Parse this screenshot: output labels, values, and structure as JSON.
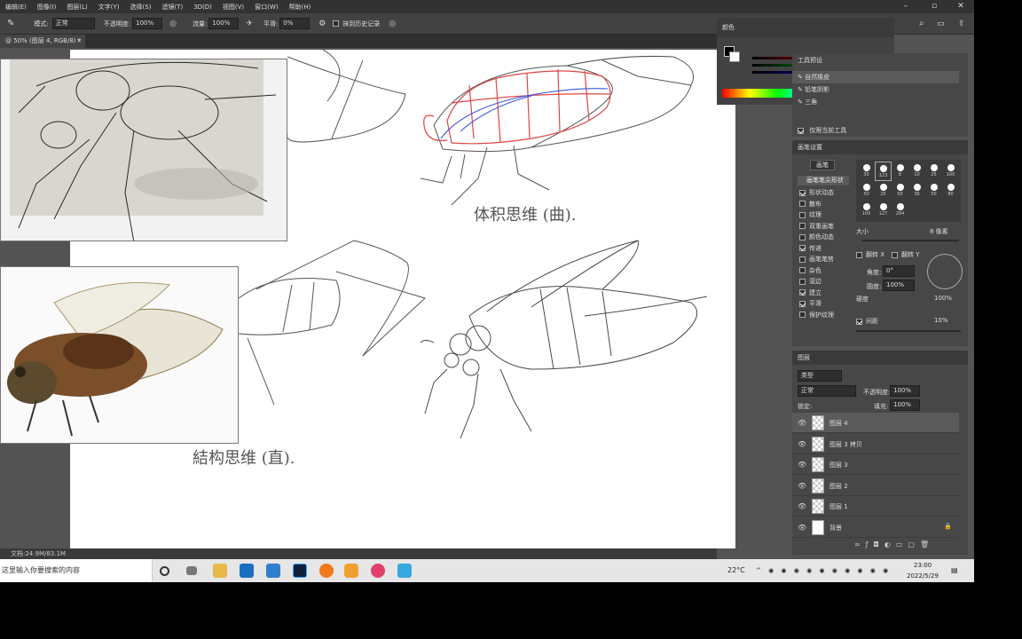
{
  "menubar": {
    "items": [
      "编辑(E)",
      "图像(I)",
      "图层(L)",
      "文字(Y)",
      "选择(S)",
      "滤镜(T)",
      "3D(D)",
      "视图(V)",
      "窗口(W)",
      "帮助(H)"
    ]
  },
  "options": {
    "mode_label": "模式:",
    "mode_value": "正常",
    "opacity_label": "不透明度:",
    "opacity_value": "100%",
    "flow_label": "流量:",
    "flow_value": "100%",
    "smooth_label": "平滑:",
    "smooth_value": "0%",
    "erase_history": "抹到历史记录"
  },
  "tab": {
    "title": "@ 50% (图层 4, RGB/8) *",
    "close": "×"
  },
  "canvas": {
    "caption_volume": "体积思维 (曲).",
    "caption_structure": "結构思维 (直)."
  },
  "status": {
    "doc_info": "文档:24.9M/83.1M"
  },
  "color_panel": {
    "title": "颜色"
  },
  "presets_panel": {
    "title": "工具预设",
    "items": [
      "自然橡皮",
      "铅笔阴影",
      "三角"
    ],
    "current_tool_only": "仅限当前工具"
  },
  "brush_panel": {
    "title": "画笔设置",
    "brushes_button": "画笔",
    "tip_shape": "画笔笔尖形状",
    "options": [
      {
        "label": "形状动态",
        "checked": true
      },
      {
        "label": "散布",
        "checked": false
      },
      {
        "label": "纹理",
        "checked": false
      },
      {
        "label": "双重画笔",
        "checked": false
      },
      {
        "label": "颜色动态",
        "checked": false
      },
      {
        "label": "传递",
        "checked": true
      },
      {
        "label": "画笔笔势",
        "checked": false
      },
      {
        "label": "杂色",
        "checked": false
      },
      {
        "label": "湿边",
        "checked": false
      },
      {
        "label": "建立",
        "checked": true
      },
      {
        "label": "平滑",
        "checked": true
      },
      {
        "label": "保护纹理",
        "checked": false
      }
    ],
    "brush_sizes": [
      "30",
      "123",
      "8",
      "10",
      "25",
      "100",
      "50",
      "25",
      "50",
      "36",
      "50",
      "80",
      "100",
      "127",
      "284"
    ],
    "size_label": "大小",
    "size_value": "8 像素",
    "flip_x": "翻转 X",
    "flip_y": "翻转 Y",
    "angle_label": "角度:",
    "angle_value": "0°",
    "roundness_label": "圆度:",
    "roundness_value": "100%",
    "hardness_label": "硬度",
    "hardness_value": "100%",
    "spacing_label": "间距",
    "spacing_value": "10%"
  },
  "layers_panel": {
    "title": "图层",
    "kind": "类型",
    "blend": "正常",
    "opacity_label": "不透明度:",
    "opacity_value": "100%",
    "lock_label": "锁定:",
    "fill_label": "填充:",
    "fill_value": "100%",
    "layers": [
      {
        "name": "图层 4",
        "selected": true
      },
      {
        "name": "图层 3 拷贝",
        "selected": false
      },
      {
        "name": "图层 3",
        "selected": false
      },
      {
        "name": "图层 2",
        "selected": false
      },
      {
        "name": "图层 1",
        "selected": false
      },
      {
        "name": "背景",
        "selected": false
      }
    ]
  },
  "taskbar": {
    "search_placeholder": "这里输入你要搜索的内容",
    "temperature": "22°C",
    "time": "23:00",
    "date": "2022/5/29"
  }
}
